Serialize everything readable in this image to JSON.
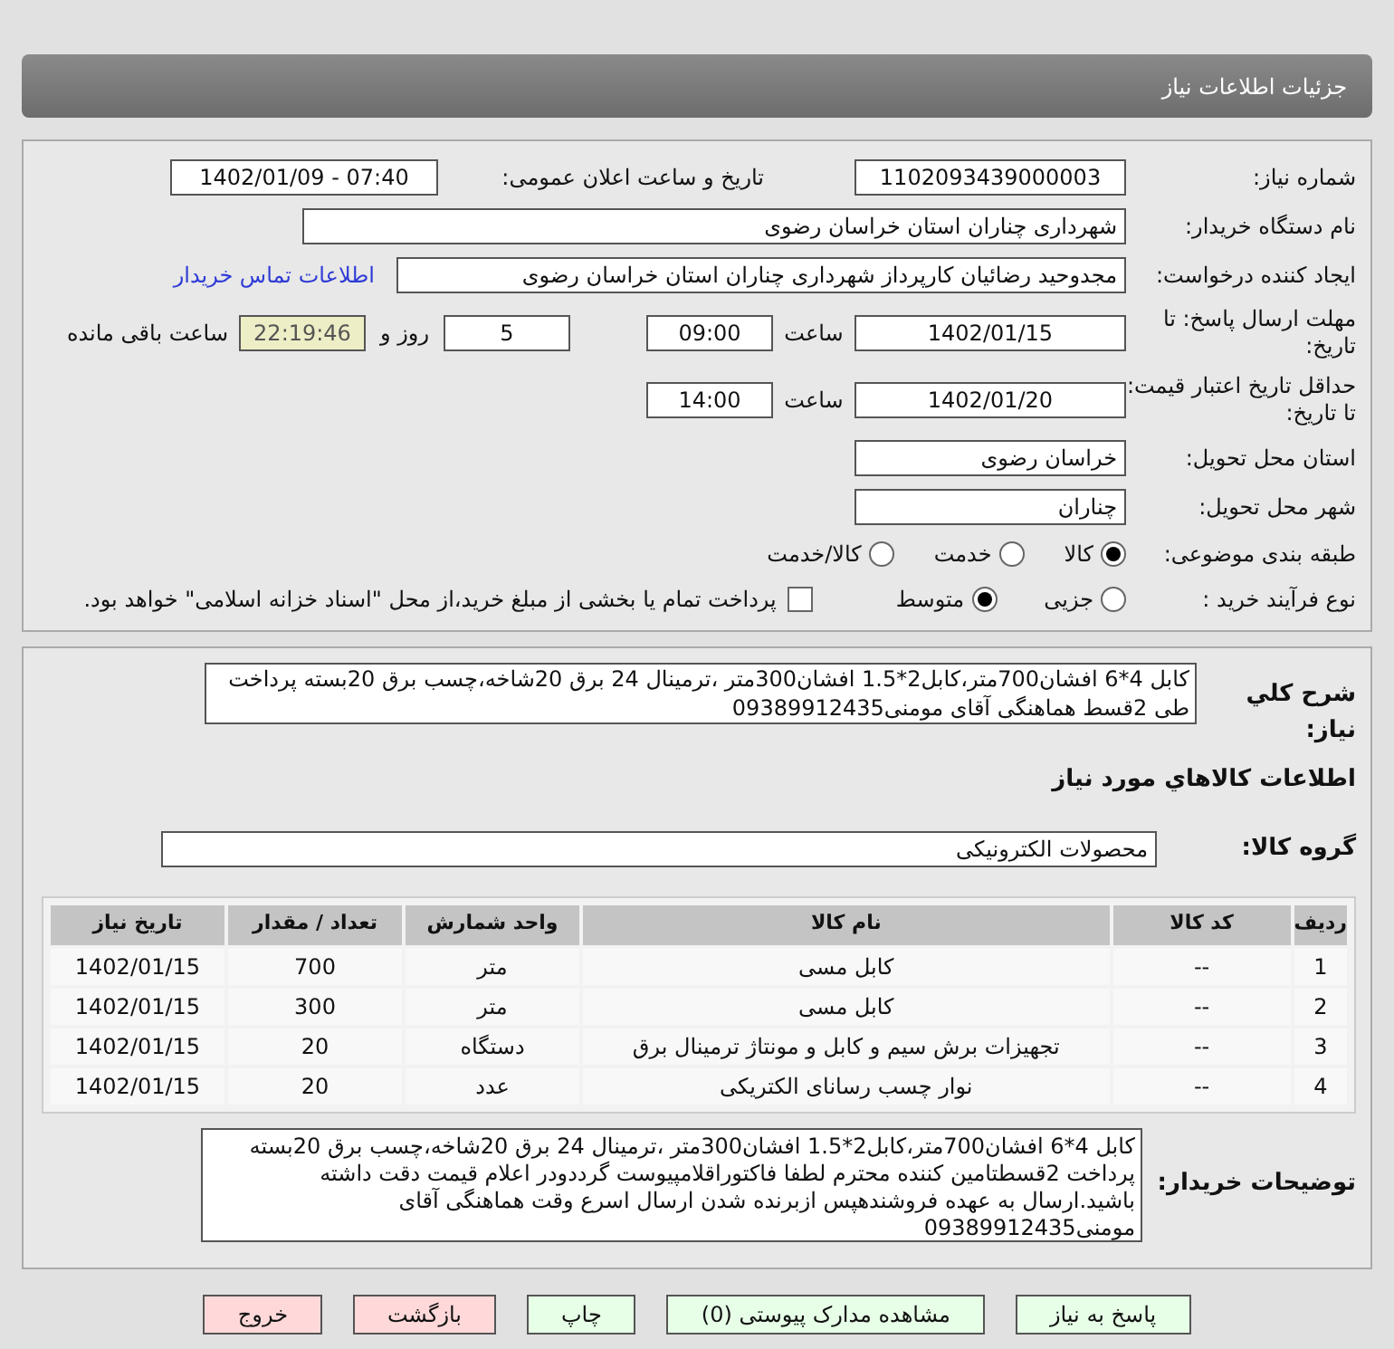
{
  "header": {
    "title": "جزئیات اطلاعات نیاز"
  },
  "need_number": {
    "label": "شماره نیاز:",
    "value": "1102093439000003"
  },
  "announce": {
    "label": "تاریخ و ساعت اعلان عمومی:",
    "value": "1402/01/09 - 07:40"
  },
  "buyer_org": {
    "label": "نام دستگاه خریدار:",
    "value": "شهرداری چناران استان خراسان رضوی"
  },
  "requester": {
    "label": "ایجاد کننده درخواست:",
    "value": "مجدوحید رضائیان کارپرداز شهرداری چناران استان خراسان رضوی",
    "link": "اطلاعات تماس خریدار"
  },
  "deadline": {
    "label": "مهلت ارسال پاسخ: تا تاریخ:",
    "date": "1402/01/15",
    "time_label": "ساعت",
    "time": "09:00",
    "days": "5",
    "days_label": "روز و",
    "remaining": "22:19:46",
    "remaining_label": "ساعت باقی مانده"
  },
  "validity": {
    "label": "حداقل تاریخ اعتبار قیمت: تا تاریخ:",
    "date": "1402/01/20",
    "time_label": "ساعت",
    "time": "14:00"
  },
  "province": {
    "label": "استان محل تحویل:",
    "value": "خراسان رضوی"
  },
  "city": {
    "label": "شهر محل تحویل:",
    "value": "چناران"
  },
  "category": {
    "label": "طبقه بندی موضوعی:",
    "options": [
      {
        "label": "کالا",
        "selected": true
      },
      {
        "label": "خدمت",
        "selected": false
      },
      {
        "label": "کالا/خدمت",
        "selected": false
      }
    ]
  },
  "process": {
    "label": "نوع فرآیند خرید :",
    "options": [
      {
        "label": "جزیی",
        "selected": false
      },
      {
        "label": "متوسط",
        "selected": true
      }
    ],
    "checkbox": {
      "label": "پرداخت تمام یا بخشی از مبلغ خرید،از محل \"اسناد خزانه اسلامی\" خواهد بود.",
      "checked": false
    }
  },
  "description": {
    "label": "شرح کلي نياز:",
    "text": "کابل 4*6 افشان700متر،کابل2*1.5 افشان300متر ،ترمینال 24 برق 20شاخه،چسب برق 20بسته پرداخت طی 2قسط هماهنگی آقای مومنی09389912435"
  },
  "goods_title": "اطلاعات کالاهاي مورد نياز",
  "goods_group": {
    "label": "گروه کالا:",
    "value": "محصولات الکترونیکی"
  },
  "table": {
    "columns": [
      "ردیف",
      "کد کالا",
      "نام کالا",
      "واحد شمارش",
      "تعداد / مقدار",
      "تاریخ نیاز"
    ],
    "rows": [
      [
        "1",
        "--",
        "کابل مسی",
        "متر",
        "700",
        "1402/01/15"
      ],
      [
        "2",
        "--",
        "کابل مسی",
        "متر",
        "300",
        "1402/01/15"
      ],
      [
        "3",
        "--",
        "تجهیزات برش سیم و کابل و مونتاژ ترمینال برق",
        "دستگاه",
        "20",
        "1402/01/15"
      ],
      [
        "4",
        "--",
        "نوار چسب رسانای الکتریکی",
        "عدد",
        "20",
        "1402/01/15"
      ]
    ]
  },
  "buyer_notes": {
    "label": "توضیحات خریدار:",
    "text": "کابل 4*6 افشان700متر،کابل2*1.5 افشان300متر ،ترمینال 24 برق 20شاخه،چسب برق 20بسته پرداخت 2قسطتامین کننده محترم لطفا فاکتوراقلامپیوست گرددودر اعلام قیمت دقت داشته باشید.ارسال به عهده فروشندهپس ازبرنده شدن ارسال اسرع وقت هماهنگی آقای مومنی09389912435"
  },
  "buttons": [
    {
      "label": "پاسخ به نیاز",
      "kind": "go"
    },
    {
      "label": "مشاهده مدارک پیوستی (0)",
      "kind": "go"
    },
    {
      "label": "چاپ",
      "kind": "go"
    },
    {
      "label": "بازگشت",
      "kind": "stop"
    },
    {
      "label": "خروج",
      "kind": "stop"
    }
  ]
}
